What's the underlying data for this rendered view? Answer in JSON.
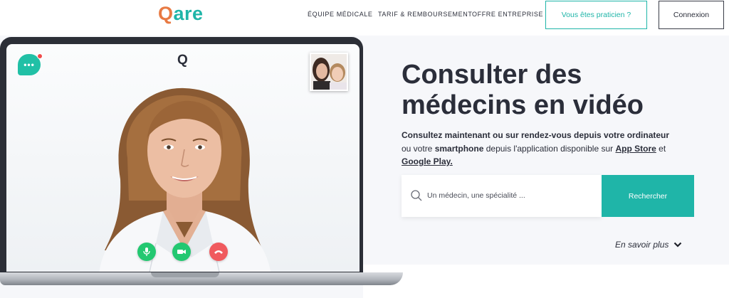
{
  "header": {
    "logo_q": "Q",
    "logo_rest": "are",
    "nav": [
      "Équipe médicale",
      "Tarif & Remboursement",
      "Offre entreprise"
    ],
    "praticien_button": "Vous êtes praticien ?",
    "login_button": "Connexion"
  },
  "video": {
    "screen_logo": "Q",
    "chat_icon_glyph": "•••",
    "controls": [
      "mic-icon",
      "camera-icon",
      "hang-up-icon"
    ]
  },
  "hero": {
    "title_line1": "Consulter des",
    "title_line2": "médecins en vidéo",
    "sub_part1": "Consultez maintenant ou sur rendez-vous depuis votre ordinateur",
    "sub_part2": "ou votre ",
    "sub_smartphone": "smartphone",
    "sub_part3": " depuis l'application disponible sur ",
    "sub_appstore": "App Store",
    "sub_part4": " et",
    "sub_googleplay": "Google Play.",
    "search_placeholder": "Un médecin, une spécialité ...",
    "search_button": "Rechercher",
    "learn_more": "En savoir plus"
  },
  "colors": {
    "brand_teal": "#1fb5a8",
    "brand_orange": "#e87a43",
    "call_green": "#23c871",
    "call_red": "#f05a5e",
    "text_dark": "#2b2e3a"
  }
}
